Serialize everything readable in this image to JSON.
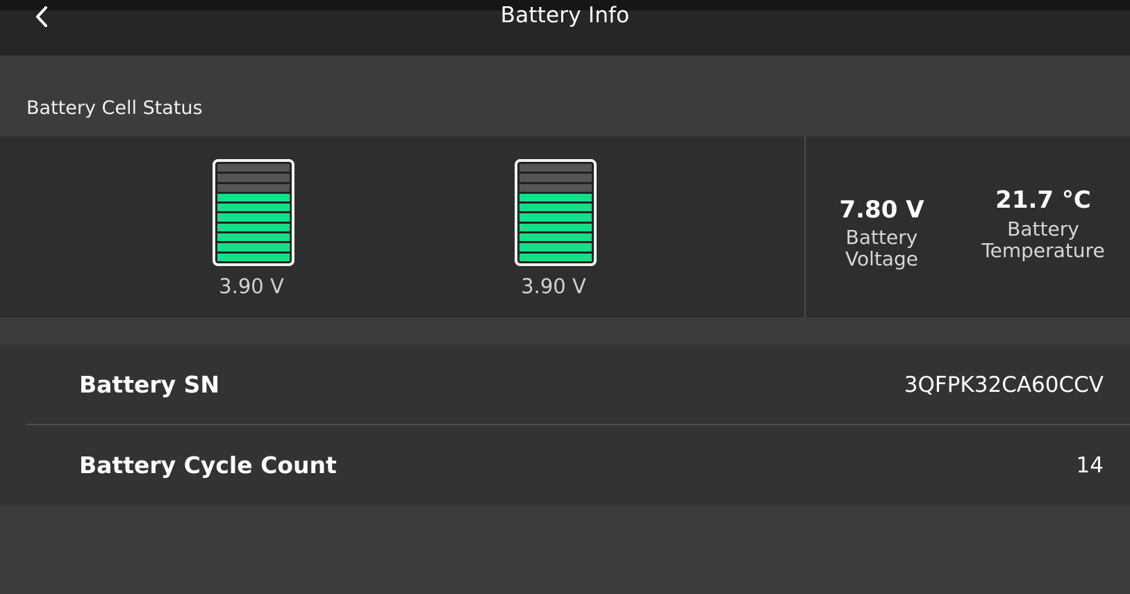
{
  "header": {
    "title": "Battery Info"
  },
  "cell_status": {
    "section_title": "Battery Cell Status",
    "cells": [
      {
        "voltage": "3.90 V",
        "filled_segments": 7,
        "total_segments": 10
      },
      {
        "voltage": "3.90 V",
        "filled_segments": 7,
        "total_segments": 10
      }
    ],
    "accent_color": "#14e08a"
  },
  "stats": {
    "voltage": {
      "value": "7.80 V",
      "label": "Battery Voltage"
    },
    "temperature": {
      "value": "21.7 °C",
      "label_line1": "Battery",
      "label_line2": "Temperature"
    }
  },
  "info": {
    "serial_label": "Battery SN",
    "serial_value": "3QFPK32CA60CCV",
    "cycle_label": "Battery Cycle Count",
    "cycle_value": "14"
  },
  "icons": {
    "back": "chevron-left-icon"
  }
}
